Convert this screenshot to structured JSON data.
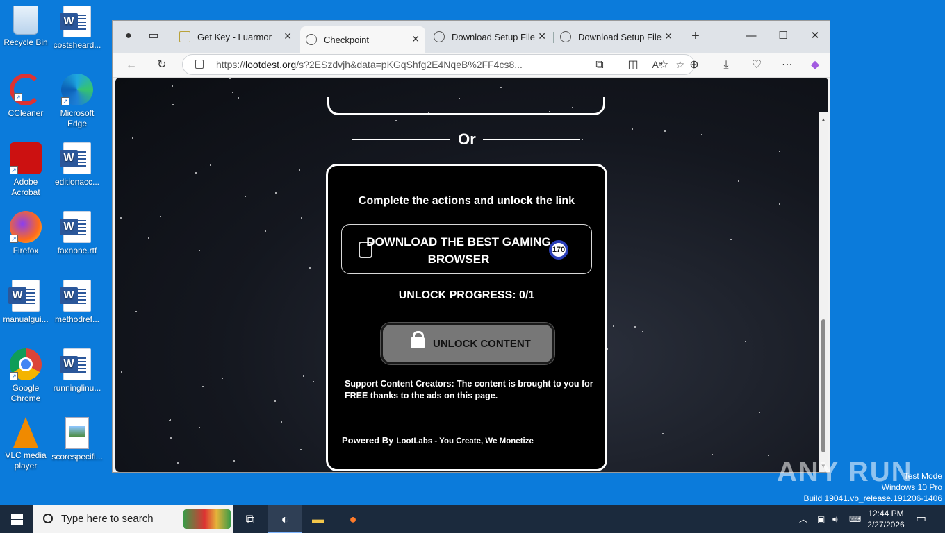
{
  "desktop": {
    "icons": [
      {
        "label": "Recycle Bin"
      },
      {
        "label": "costsheard..."
      },
      {
        "label": "CCleaner"
      },
      {
        "label": "Microsoft Edge"
      },
      {
        "label": "Adobe Acrobat"
      },
      {
        "label": "editionacc..."
      },
      {
        "label": "Firefox"
      },
      {
        "label": "faxnone.rtf"
      },
      {
        "label": "manualgui..."
      },
      {
        "label": "methodref..."
      },
      {
        "label": "Google Chrome"
      },
      {
        "label": "runninglinu..."
      },
      {
        "label": "VLC media player"
      },
      {
        "label": "scorespecifi..."
      }
    ]
  },
  "browser": {
    "tabs": [
      {
        "label": "Get Key - Luarmor"
      },
      {
        "label": "Checkpoint"
      },
      {
        "label": "Download Setup File"
      },
      {
        "label": "Download Setup File"
      }
    ],
    "url_domain": "lootdest.org",
    "url_prefix": "https://",
    "url_rest": "/s?2ESzdvjh&data=pKGqShfg2E4NqeB%2FF4cs8..."
  },
  "page": {
    "or_text": "Or",
    "card_title": "Complete the actions and unlock the link",
    "download_label": "DOWNLOAD THE BEST GAMING BROWSER",
    "badge": "170",
    "progress": "UNLOCK PROGRESS: 0/1",
    "unlock_label": "UNLOCK CONTENT",
    "support_text": "Support Content Creators: The content is brought to you for FREE thanks to the ads on this page.",
    "powered_by": "Powered By",
    "powered_brand": "LootLabs - You Create, We Monetize"
  },
  "watermark": {
    "brand": "ANY RUN",
    "line1": "Test Mode",
    "line2": "Windows 10 Pro",
    "line3": "Build 19041.vb_release.191206-1406"
  },
  "taskbar": {
    "search_placeholder": "Type here to search",
    "time": "12:44 PM",
    "date": "2/27/2026"
  }
}
